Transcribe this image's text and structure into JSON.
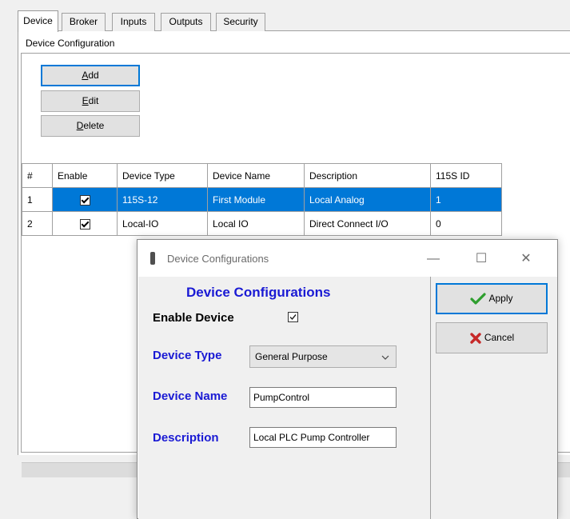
{
  "tabs": [
    "Device",
    "Broker",
    "Inputs",
    "Outputs",
    "Security"
  ],
  "group_title": "Device Configuration",
  "buttons": {
    "add_u": "A",
    "add_rest": "dd",
    "edit_u": "E",
    "edit_rest": "dit",
    "delete_u": "D",
    "delete_rest": "elete"
  },
  "grid": {
    "columns": [
      "#",
      "Enable",
      "Device Type",
      "Device Name",
      "Description",
      "115S ID"
    ],
    "rows": [
      {
        "num": "1",
        "enabled": true,
        "type": "115S-12",
        "name": "First Module",
        "description": "Local Analog",
        "id": "1"
      },
      {
        "num": "2",
        "enabled": true,
        "type": "Local-IO",
        "name": "Local IO",
        "description": "Direct Connect I/O",
        "id": "0"
      }
    ]
  },
  "dialog": {
    "title": "Device Configurations",
    "heading": "Device Configurations",
    "enable_label": "Enable Device",
    "enable_checked": true,
    "type_label": "Device Type",
    "type_value": "General Purpose",
    "name_label": "Device Name",
    "name_value": "PumpControl",
    "desc_label": "Description",
    "desc_value": "Local PLC Pump Controller",
    "apply_label": "Apply",
    "cancel_label": "Cancel",
    "minimize": "—",
    "maximize": "☐",
    "close": "✕"
  },
  "colors": {
    "accent": "#0078d7",
    "label_blue": "#1a1ad4",
    "apply_icon": "#2e9e2e",
    "cancel_icon": "#c62828"
  }
}
